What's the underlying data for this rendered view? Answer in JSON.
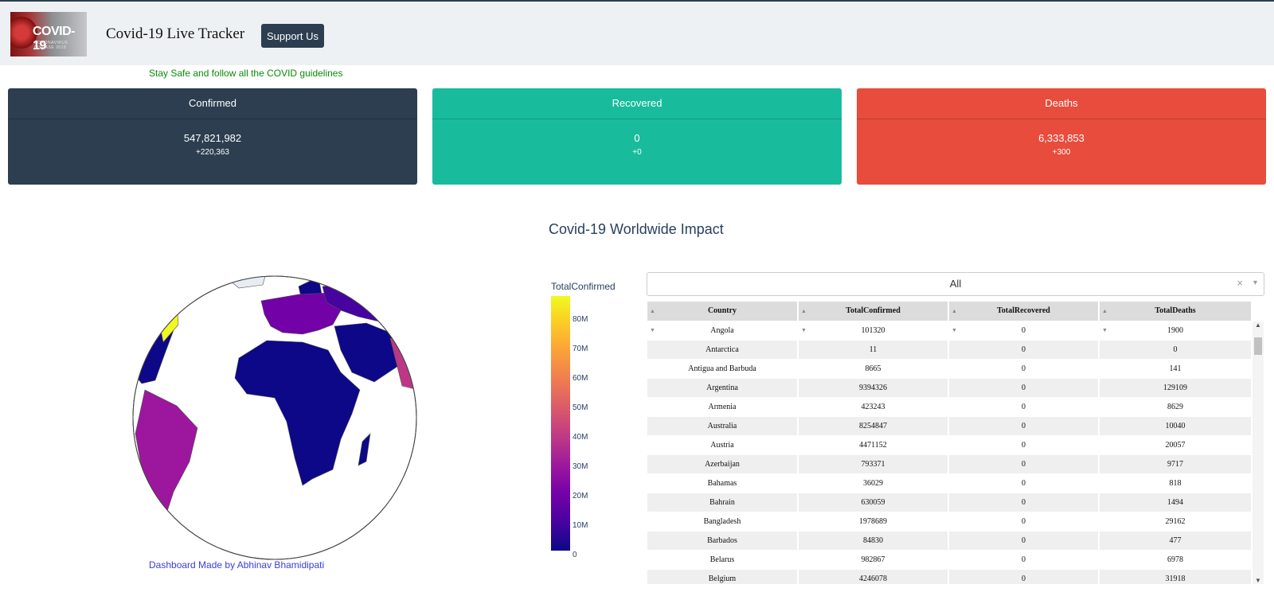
{
  "navbar": {
    "logo_text": "COVID-19",
    "logo_sub": "CORONAVIRUS DISEASE 2019",
    "brand": "Covid-19 Live Tracker",
    "support_label": "Support Us"
  },
  "tagline": "Stay Safe and follow all the COVID guidelines",
  "cards": {
    "confirmed": {
      "label": "Confirmed",
      "value": "547,821,982",
      "delta": "+220,363",
      "color": "#2c3e50"
    },
    "recovered": {
      "label": "Recovered",
      "value": "0",
      "delta": "+0",
      "color": "#18bc9c"
    },
    "deaths": {
      "label": "Deaths",
      "value": "6,333,853",
      "delta": "+300",
      "color": "#e74c3c"
    }
  },
  "impact_title": "Covid-19 Worldwide Impact",
  "map": {
    "colorbar_title": "TotalConfirmed",
    "ticks": [
      "80M",
      "70M",
      "60M",
      "50M",
      "40M",
      "30M",
      "20M",
      "10M",
      "0"
    ],
    "colorscale": [
      "#0d0887",
      "#46039f",
      "#7201a8",
      "#9c179e",
      "#bd3786",
      "#d8576b",
      "#ed7953",
      "#fb9f3a",
      "#fdca26",
      "#f0f921"
    ]
  },
  "credit": "Dashboard Made by Abhinav Bhamidipati",
  "filter": {
    "value": "All",
    "clear": "×",
    "arrow": "▾"
  },
  "table": {
    "columns": [
      "Country",
      "TotalConfirmed",
      "TotalRecovered",
      "TotalDeaths"
    ],
    "rows": [
      [
        "Angola",
        "101320",
        "0",
        "1900"
      ],
      [
        "Antarctica",
        "11",
        "0",
        "0"
      ],
      [
        "Antigua and Barbuda",
        "8665",
        "0",
        "141"
      ],
      [
        "Argentina",
        "9394326",
        "0",
        "129109"
      ],
      [
        "Armenia",
        "423243",
        "0",
        "8629"
      ],
      [
        "Australia",
        "8254847",
        "0",
        "10040"
      ],
      [
        "Austria",
        "4471152",
        "0",
        "20057"
      ],
      [
        "Azerbaijan",
        "793371",
        "0",
        "9717"
      ],
      [
        "Bahamas",
        "36029",
        "0",
        "818"
      ],
      [
        "Bahrain",
        "630059",
        "0",
        "1494"
      ],
      [
        "Bangladesh",
        "1978689",
        "0",
        "29162"
      ],
      [
        "Barbados",
        "84830",
        "0",
        "477"
      ],
      [
        "Belarus",
        "982867",
        "0",
        "6978"
      ],
      [
        "Belgium",
        "4246078",
        "0",
        "31918"
      ]
    ]
  }
}
